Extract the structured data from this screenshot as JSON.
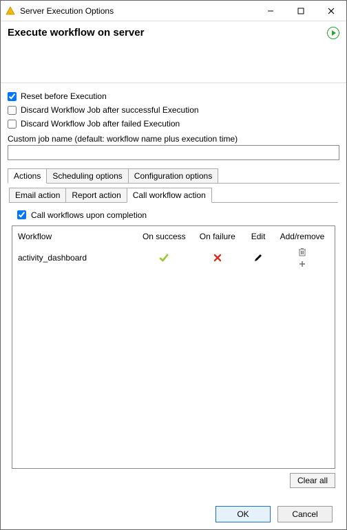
{
  "window": {
    "title": "Server Execution Options"
  },
  "header": {
    "title": "Execute workflow on server"
  },
  "options": {
    "reset_label": "Reset before Execution",
    "reset_checked": true,
    "discard_success_label": "Discard Workflow Job after successful Execution",
    "discard_success_checked": false,
    "discard_failed_label": "Discard Workflow Job after failed Execution",
    "discard_failed_checked": false,
    "custom_job_label": "Custom job name (default: workflow name plus execution time)",
    "custom_job_value": ""
  },
  "top_tabs": {
    "actions": "Actions",
    "scheduling": "Scheduling options",
    "config": "Configuration options",
    "active": "actions"
  },
  "sub_tabs": {
    "email": "Email action",
    "report": "Report action",
    "call": "Call workflow action",
    "active": "call"
  },
  "call_panel": {
    "checkbox_label": "Call workflows upon completion",
    "checkbox_checked": true,
    "columns": {
      "workflow": "Workflow",
      "on_success": "On success",
      "on_failure": "On failure",
      "edit": "Edit",
      "add_remove": "Add/remove"
    },
    "rows": [
      {
        "workflow": "activity_dashboard",
        "on_success": true,
        "on_failure": false
      }
    ],
    "clear_all": "Clear all"
  },
  "footer": {
    "ok": "OK",
    "cancel": "Cancel"
  }
}
